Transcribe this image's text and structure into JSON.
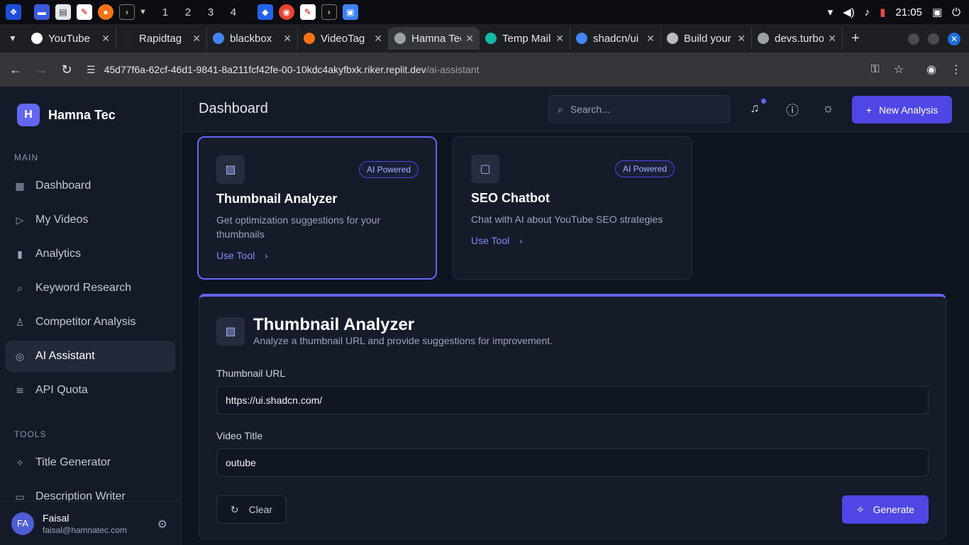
{
  "taskbar": {
    "workspaces": [
      "1",
      "2",
      "3",
      "4"
    ],
    "clock": "21:05"
  },
  "tabs": [
    {
      "title": "YouTube",
      "color": "#ffffff"
    },
    {
      "title": "Rapidtag",
      "color": "#222222"
    },
    {
      "title": "blackbox",
      "color": "#4285f4"
    },
    {
      "title": "VideoTag",
      "color": "#f97316"
    },
    {
      "title": "Hamna Tec",
      "color": "#9aa0a6"
    },
    {
      "title": "Temp Mail",
      "color": "#14b8a6"
    },
    {
      "title": "shadcn/ui",
      "color": "#4285f4"
    },
    {
      "title": "Build your",
      "color": "#bbbbbb"
    },
    {
      "title": "devs.turbo",
      "color": "#9aa0a6"
    }
  ],
  "address": {
    "url": "45d77f6a-62cf-46d1-9841-8a211fcf42fe-00-10kdc4akyfbxk.riker.replit.dev",
    "path": "/ai-assistant"
  },
  "sidebar": {
    "brand": "Hamna Tec",
    "logo_letter": "H",
    "main_label": "MAIN",
    "main_items": [
      {
        "label": "Dashboard",
        "icon": "dashboard-icon",
        "glyph": "▦"
      },
      {
        "label": "My Videos",
        "icon": "video-icon",
        "glyph": "▷"
      },
      {
        "label": "Analytics",
        "icon": "chart-icon",
        "glyph": "▮"
      },
      {
        "label": "Keyword Research",
        "icon": "search-icon",
        "glyph": "⌕"
      },
      {
        "label": "Competitor Analysis",
        "icon": "user-search-icon",
        "glyph": "♙"
      },
      {
        "label": "AI Assistant",
        "icon": "bot-icon",
        "glyph": "◎"
      },
      {
        "label": "API Quota",
        "icon": "database-icon",
        "glyph": "≋"
      }
    ],
    "tools_label": "TOOLS",
    "tool_items": [
      {
        "label": "Title Generator",
        "icon": "wand-icon",
        "glyph": "✧"
      },
      {
        "label": "Description Writer",
        "icon": "file-text-icon",
        "glyph": "▭"
      }
    ],
    "user": {
      "initials": "FA",
      "name": "Faisal",
      "email": "faisal@hamnatec.com"
    }
  },
  "header": {
    "title": "Dashboard",
    "search_placeholder": "Search...",
    "new_button": "New Analysis"
  },
  "cards": [
    {
      "badge": "AI Powered",
      "title": "Thumbnail Analyzer",
      "desc": "Get optimization suggestions for your thumbnails",
      "link": "Use Tool"
    },
    {
      "badge": "AI Powered",
      "title": "SEO Chatbot",
      "desc": "Chat with AI about YouTube SEO strategies",
      "link": "Use Tool"
    }
  ],
  "panel": {
    "title": "Thumbnail Analyzer",
    "subtitle": "Analyze a thumbnail URL and provide suggestions for improvement.",
    "url_label": "Thumbnail URL",
    "url_value": "https://ui.shadcn.com/",
    "title_label": "Video Title",
    "title_value": "outube",
    "clear": "Clear",
    "generate": "Generate"
  }
}
